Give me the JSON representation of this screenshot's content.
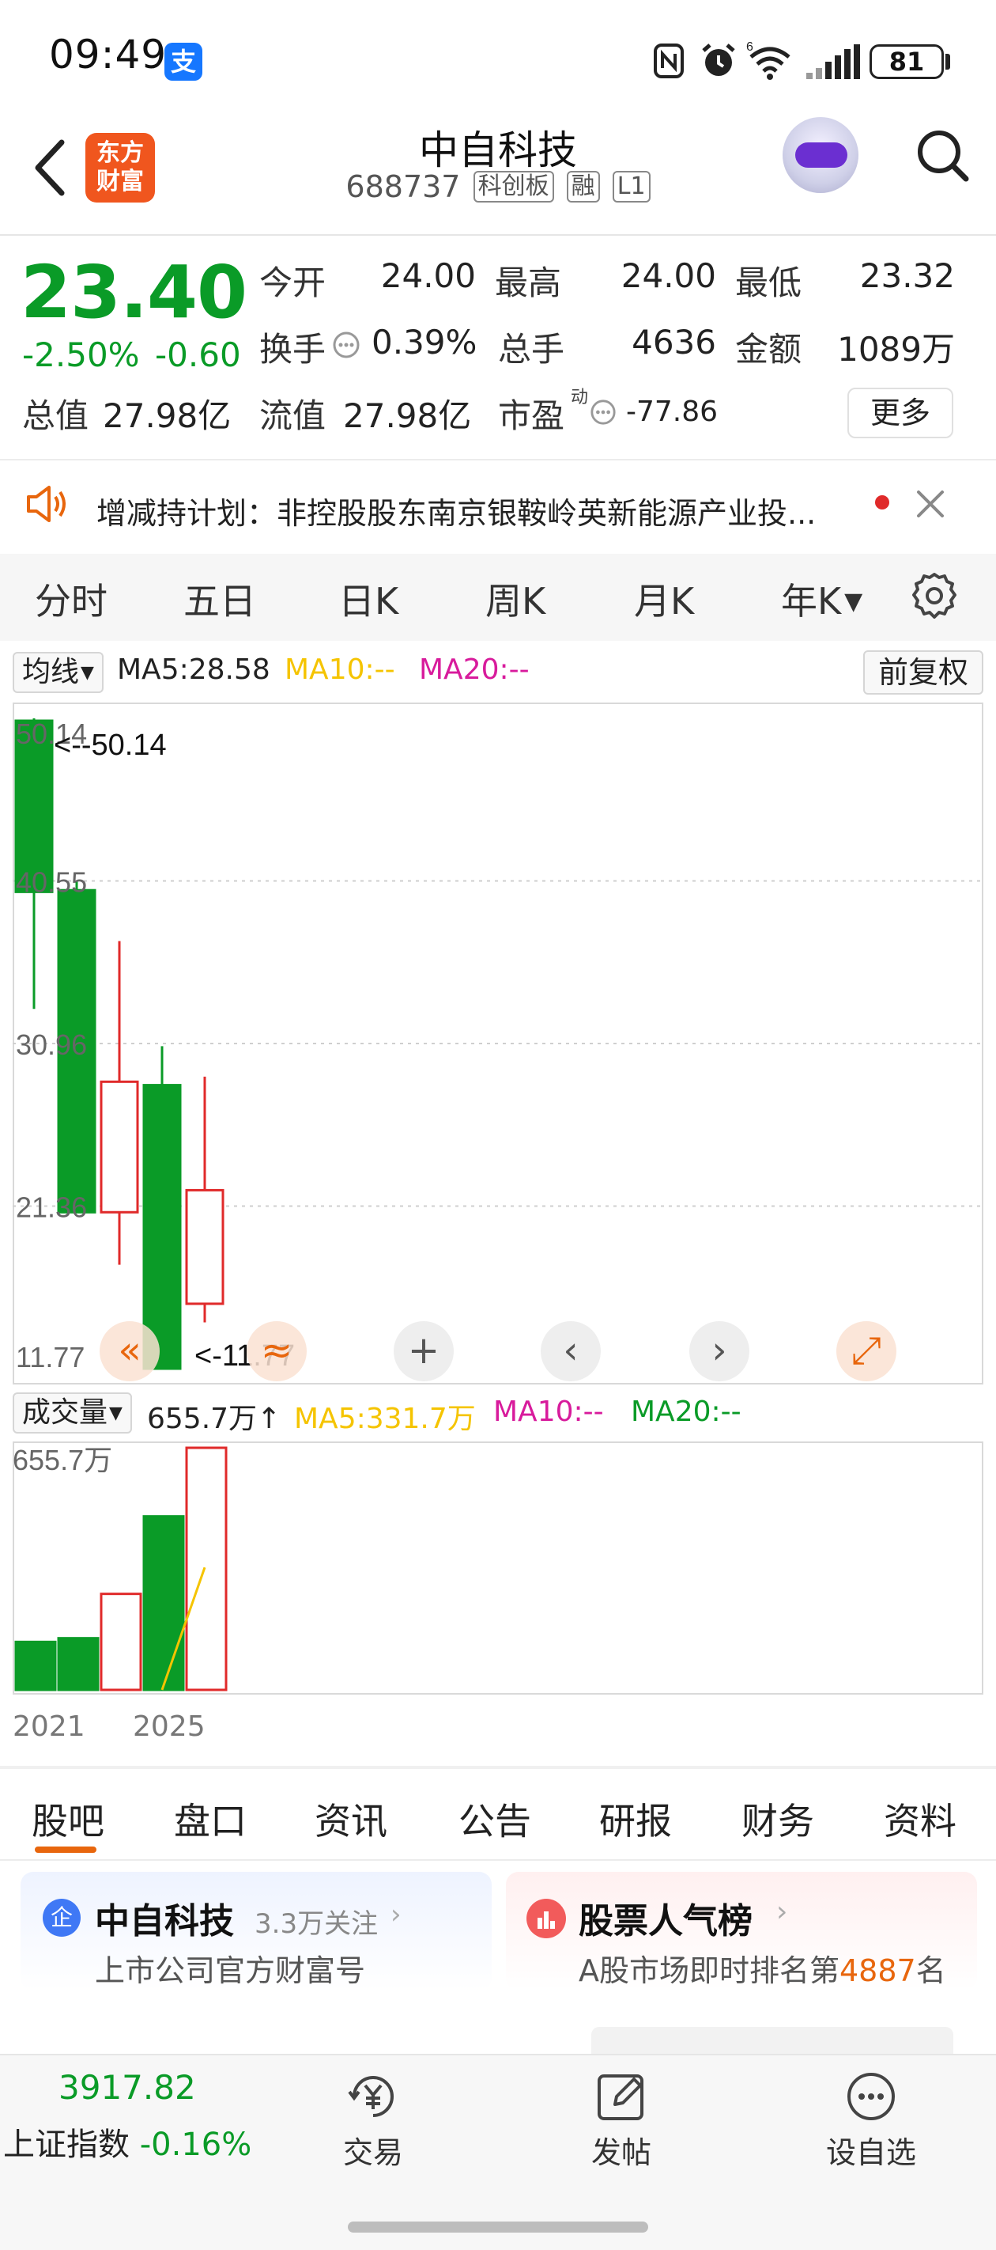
{
  "status_bar": {
    "time": "09:49",
    "alipay_badge": "支",
    "battery": "81"
  },
  "header": {
    "logo_text": "东方财富",
    "stock_name": "中自科技",
    "stock_code": "688737",
    "tags": [
      "科创板",
      "融",
      "L1"
    ]
  },
  "quote": {
    "price": "23.40",
    "change_pct": "-2.50%",
    "change_val": "-0.60",
    "open_label": "今开",
    "open": "24.00",
    "high_label": "最高",
    "high": "24.00",
    "low_label": "最低",
    "low": "23.32",
    "turnover_label": "换手",
    "turnover": "0.39%",
    "volume_label": "总手",
    "volume": "4636",
    "amount_label": "金额",
    "amount": "1089万",
    "mktcap_label": "总值",
    "mktcap": "27.98亿",
    "float_label": "流值",
    "float": "27.98亿",
    "pe_label": "市盈",
    "pe_sup": "动",
    "pe": "-77.86",
    "more": "更多"
  },
  "notice": {
    "text": "增减持计划：非控股股东南京银鞍岭英新能源产业投..."
  },
  "period_tabs": [
    "分时",
    "五日",
    "日K",
    "周K",
    "月K",
    "年K"
  ],
  "active_period": "年K",
  "kline_toolbar": {
    "ma_select": "均线",
    "ma5": "MA5:28.58",
    "ma10": "MA10:--",
    "ma20": "MA20:--",
    "fuquan": "前复权"
  },
  "volume_toolbar": {
    "select": "成交量",
    "value": "655.7万",
    "arrow": "↑",
    "ma5": "MA5:331.7万",
    "ma10": "MA10:--",
    "ma20": "MA20:--"
  },
  "colors": {
    "up": "#e02a2a",
    "down": "#0a9b27",
    "accent": "#e8660d",
    "ma5": "#f5c400",
    "ma10": "#d81b9c",
    "ma20": "#0a9b27"
  },
  "chart_data": {
    "type": "candlestick",
    "y_ticks": [
      "50.14",
      "40.55",
      "30.96",
      "21.36",
      "11.77"
    ],
    "ylim": [
      11.77,
      50.14
    ],
    "max_label": "<--50.14",
    "min_label": "<-11.77",
    "x_labels": [
      "2021",
      "2025"
    ],
    "candles": [
      {
        "open": 50.0,
        "close": 39.9,
        "high": 50.14,
        "low": 33.0,
        "dir": "down"
      },
      {
        "open": 40.0,
        "close": 21.0,
        "high": 40.55,
        "low": 22.8,
        "dir": "down"
      },
      {
        "open": 21.0,
        "close": 28.7,
        "high": 37.0,
        "low": 17.9,
        "dir": "up"
      },
      {
        "open": 28.5,
        "close": 11.77,
        "high": 30.8,
        "low": 11.77,
        "dir": "down"
      },
      {
        "open": 15.6,
        "close": 22.3,
        "high": 29.0,
        "low": 14.5,
        "dir": "up"
      }
    ],
    "volume": {
      "max_label": "655.7万",
      "ylim": [
        0,
        655.7
      ],
      "values": [
        130,
        140,
        260,
        470,
        655.7
      ],
      "dirs": [
        "down",
        "down",
        "up",
        "down",
        "up"
      ],
      "ma5_line": [
        [
          3,
          0
        ],
        [
          4,
          331.7
        ]
      ]
    }
  },
  "chart_controls": [
    "«",
    "≈",
    "+",
    "‹",
    "›",
    "⤢"
  ],
  "bottom_tabs": [
    "股吧",
    "盘口",
    "资讯",
    "公告",
    "研报",
    "财务",
    "资料"
  ],
  "active_bottom_tab": "股吧",
  "cards": {
    "left": {
      "badge": "企",
      "title": "中自科技",
      "follow": "3.3万关注",
      "sub": "上市公司官方财富号"
    },
    "right": {
      "title": "股票人气榜",
      "sub_prefix": "A股市场即时排名第",
      "rank": "4887",
      "sub_suffix": "名"
    }
  },
  "bottom_nav": {
    "index_value": "3917.82",
    "index_name": "上证指数",
    "index_change": "-0.16%",
    "trade": "交易",
    "post": "发帖",
    "watchlist": "设自选"
  }
}
